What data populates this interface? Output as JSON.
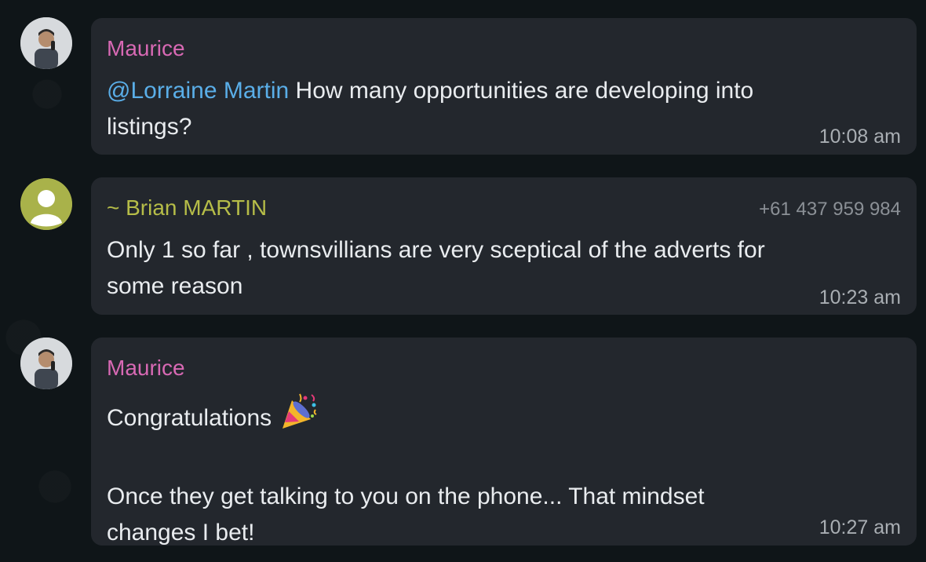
{
  "messages": [
    {
      "sender": "Maurice",
      "sender_color": "#d869b4",
      "mention": "@Lorraine Martin",
      "text_after_mention": " How many opportunities are developing into",
      "text_line2": "listings?",
      "time": "10:08 am",
      "avatar_icon": "maurice-photo"
    },
    {
      "sender": "~ Brian MARTIN",
      "sender_color": "#b6bd48",
      "phone": "+61 437 959 984",
      "text_line1": "Only 1 so far , townsvillians are very sceptical of the adverts for",
      "text_line2": "some reason",
      "time": "10:23 am",
      "avatar_icon": "default-user-icon"
    },
    {
      "sender": "Maurice",
      "sender_color": "#d869b4",
      "text_line1": "Congratulations",
      "emoji": "party-popper-emoji",
      "text_line3": "Once they get talking to you on the phone... That mindset",
      "text_line4": "changes I bet!",
      "time": "10:27 am",
      "avatar_icon": "maurice-photo"
    }
  ]
}
